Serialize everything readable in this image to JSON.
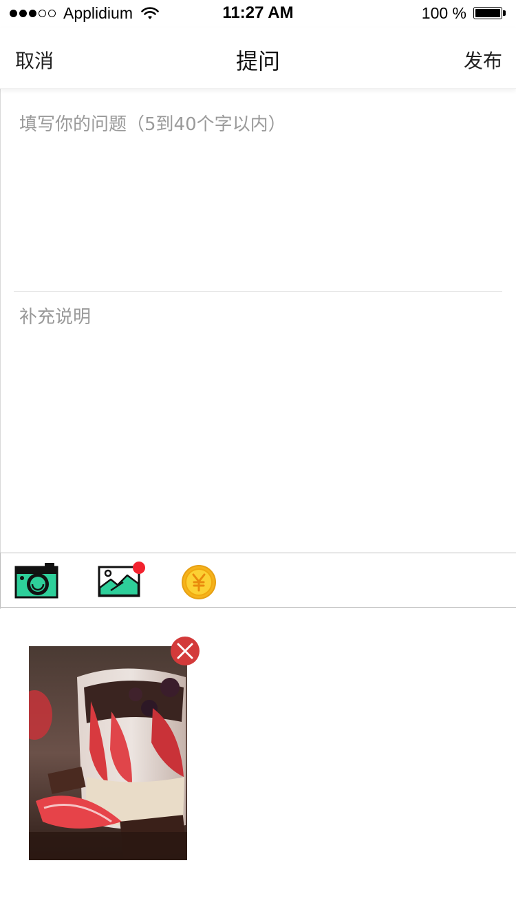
{
  "status_bar": {
    "carrier": "Applidium",
    "time": "11:27 AM",
    "battery": "100 %",
    "signal_bars_filled": 3,
    "signal_bars_total": 5
  },
  "nav": {
    "cancel_label": "取消",
    "title": "提问",
    "publish_label": "发布"
  },
  "form": {
    "question_placeholder": "填写你的问题（5到40个字以内）",
    "question_value": "",
    "description_placeholder": "补充说明",
    "description_value": ""
  },
  "toolbar": {
    "items": [
      {
        "icon": "camera-icon",
        "color": "#2ecf9a"
      },
      {
        "icon": "image-icon",
        "color": "#2ecf9a",
        "badge": true,
        "badge_color": "#f2222e"
      },
      {
        "icon": "yuan-coin-icon",
        "color": "#f5b21b"
      }
    ]
  },
  "attachments": [
    {
      "icon": "photo-thumbnail",
      "remove_icon": "close-icon",
      "remove_color": "#d33a3a"
    }
  ],
  "colors": {
    "accent_green": "#2ecf9a",
    "coin_orange": "#f5b21b",
    "placeholder_gray": "#9a9a9a",
    "badge_red": "#f2222e"
  }
}
